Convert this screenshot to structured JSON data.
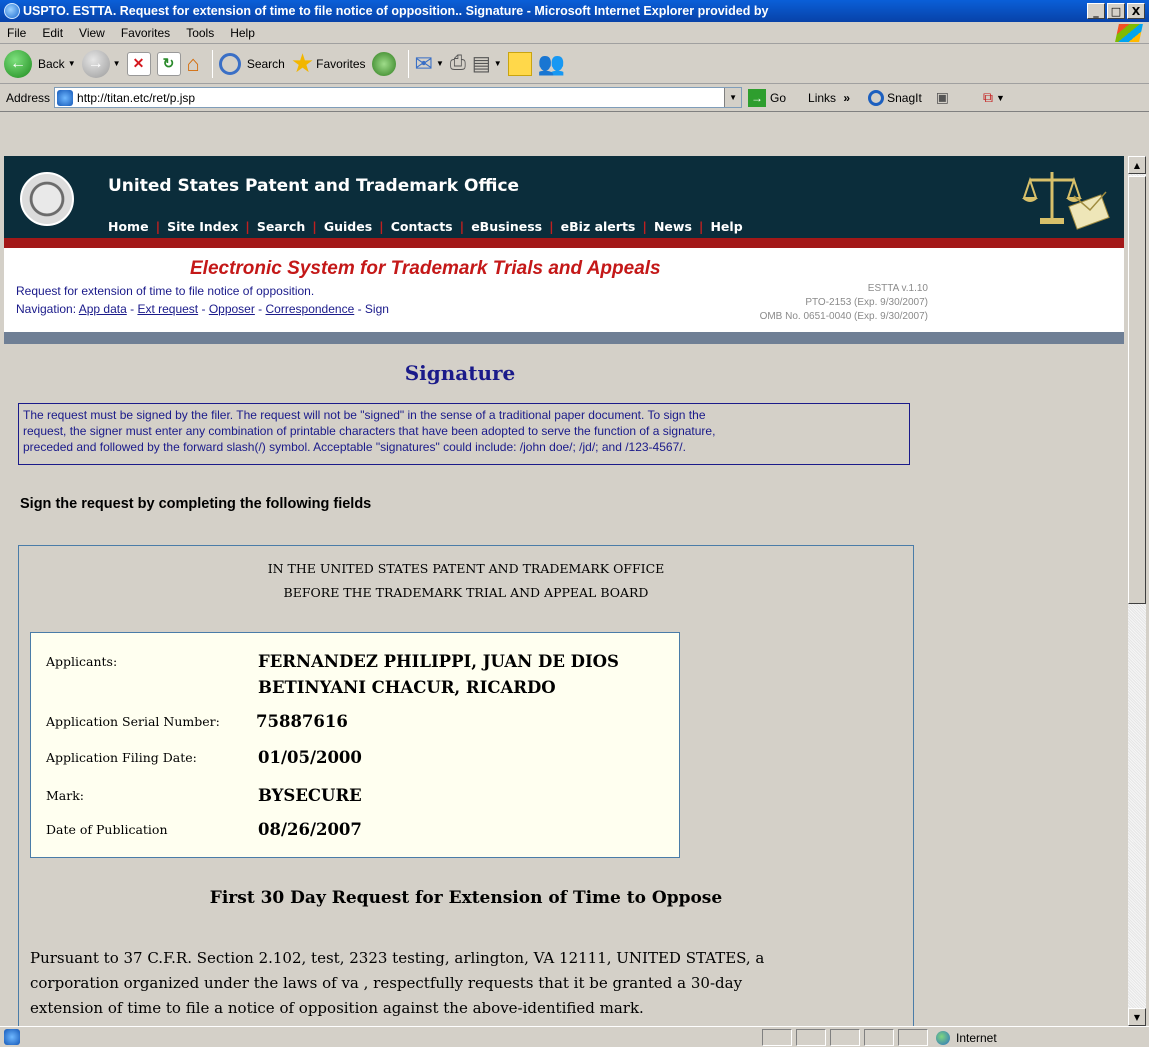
{
  "window": {
    "title": "USPTO. ESTTA. Request for extension of time to file notice of opposition.. Signature - Microsoft Internet Explorer provided by",
    "minimize": "_",
    "maximize": "□",
    "close": "X"
  },
  "menu": [
    "File",
    "Edit",
    "View",
    "Favorites",
    "Tools",
    "Help"
  ],
  "toolbar": {
    "back_label": "Back",
    "search_label": "Search",
    "favorites_label": "Favorites"
  },
  "address": {
    "label": "Address",
    "url": "http://titan.etc/ret/p.jsp",
    "go_label": "Go",
    "links_label": "Links",
    "chevron": "»",
    "snagit_label": "SnagIt"
  },
  "uspto": {
    "title": "United States Patent and Trademark Office",
    "nav": [
      "Home",
      "Site Index",
      "Search",
      "Guides",
      "Contacts",
      "eBusiness",
      "eBiz alerts",
      "News",
      "Help"
    ],
    "separator": "|"
  },
  "estta": {
    "title": "Electronic System for Trademark Trials and Appeals",
    "subtitle": "Request for extension of time to file notice of opposition.",
    "nav_prefix": "Navigation:",
    "nav_links": [
      "App data",
      "Ext request",
      "Opposer",
      "Correspondence"
    ],
    "nav_current": "Sign",
    "nav_sep": " - ",
    "version": "ESTTA v.1.10",
    "pto_form": "PTO-2153 (Exp. 9/30/2007)",
    "omb": "OMB No. 0651-0040 (Exp. 9/30/2007)"
  },
  "page": {
    "heading": "Signature",
    "notice_lines": [
      "The request must be signed by the filer. The request will not be \"signed\" in the sense of a traditional paper document. To sign the",
      "request, the signer must enter any combination of printable characters that have been adopted to serve the function of a signature,",
      "preceded and followed by the forward slash(/) symbol. Acceptable \"signatures\" could include: /john doe/; /jd/; and /123-4567/."
    ],
    "sign_instruction": "Sign the request by completing the following fields",
    "court_line1": "IN THE UNITED STATES PATENT AND TRADEMARK OFFICE",
    "court_line2": "BEFORE THE TRADEMARK TRIAL AND APPEAL BOARD",
    "applicants_label": "Applicants:",
    "applicants": [
      "FERNANDEZ PHILIPPI, JUAN DE DIOS",
      "BETINYANI CHACUR, RICARDO"
    ],
    "serial_label": "Application Serial Number:",
    "serial": "75887616",
    "filing_label": "Application Filing Date:",
    "filing": "01/05/2000",
    "mark_label": "Mark:",
    "mark": "BYSECURE",
    "pub_label": "Date of Publication",
    "pub": "08/26/2007",
    "request_heading": "First 30 Day Request for Extension of Time to Oppose",
    "pursuant_lines": [
      "Pursuant to 37 C.F.R. Section 2.102, test, 2323 testing, arlington, VA 12111, UNITED STATES, a",
      "corporation organized under the laws of va , respectfully requests that it be granted a 30-day",
      "extension of time to file a notice of opposition against the above-identified mark."
    ]
  },
  "status": {
    "zone": "Internet"
  }
}
